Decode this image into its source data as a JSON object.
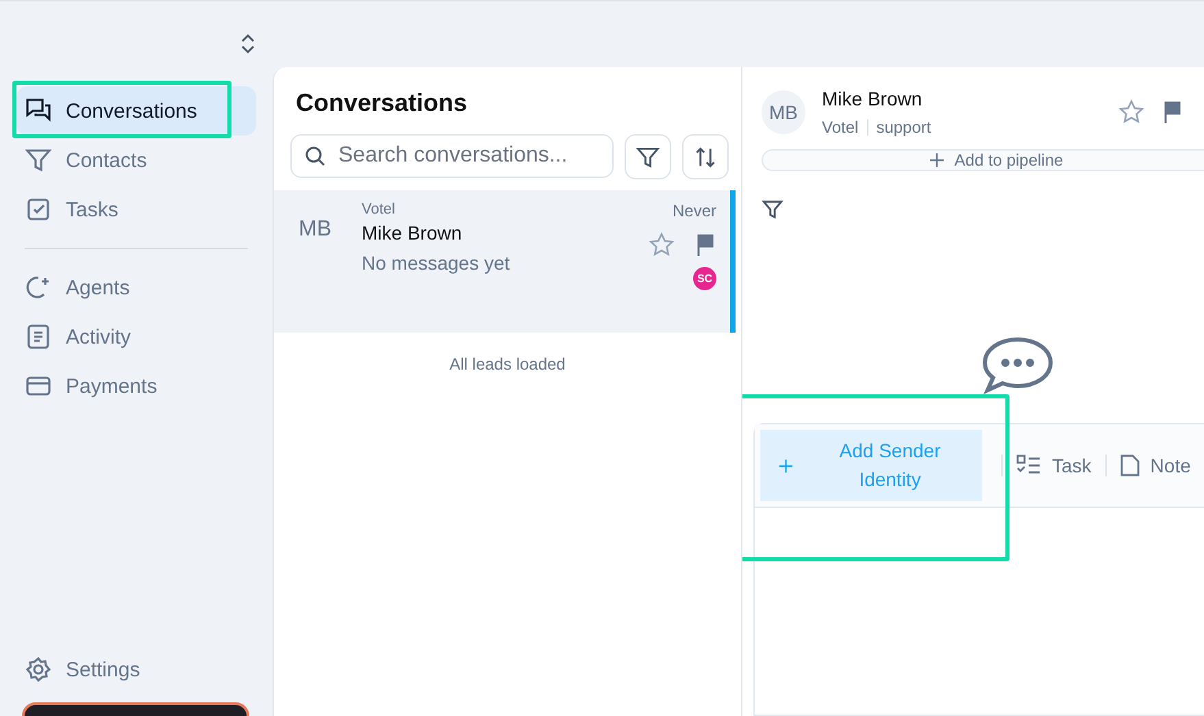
{
  "sidebar": {
    "items": [
      {
        "label": "Conversations",
        "selected": true,
        "highlighted": true
      },
      {
        "label": "Contacts",
        "selected": false,
        "highlighted": false
      },
      {
        "label": "Tasks",
        "selected": false,
        "highlighted": false
      },
      {
        "label": "Agents",
        "selected": false,
        "highlighted": false
      },
      {
        "label": "Activity",
        "selected": false,
        "highlighted": false
      },
      {
        "label": "Payments",
        "selected": false,
        "highlighted": false
      }
    ],
    "footer_item": {
      "label": "Settings"
    }
  },
  "list": {
    "title": "Conversations",
    "search": {
      "placeholder": "Search conversations..."
    },
    "conversations": [
      {
        "initials": "MB",
        "company": "Votel",
        "name": "Mike Brown",
        "preview": "No messages yet",
        "time": "Never",
        "starred": false,
        "flagged": true,
        "assignee": "SC",
        "color": "#e6278f",
        "selected": true
      }
    ],
    "footer": "All leads loaded"
  },
  "detail": {
    "initials": "MB",
    "name": "Mike Brown",
    "company": "Votel",
    "tag": "support",
    "starred": false,
    "flagged": true,
    "pipeline_button": "Add to pipeline",
    "composer": {
      "tabs": [
        {
          "kind": "primary",
          "label": "Add Sender Identity",
          "highlighted": true
        },
        {
          "kind": "task",
          "label": "Task",
          "highlighted": false
        },
        {
          "kind": "note",
          "label": "Note",
          "highlighted": false
        }
      ]
    }
  }
}
